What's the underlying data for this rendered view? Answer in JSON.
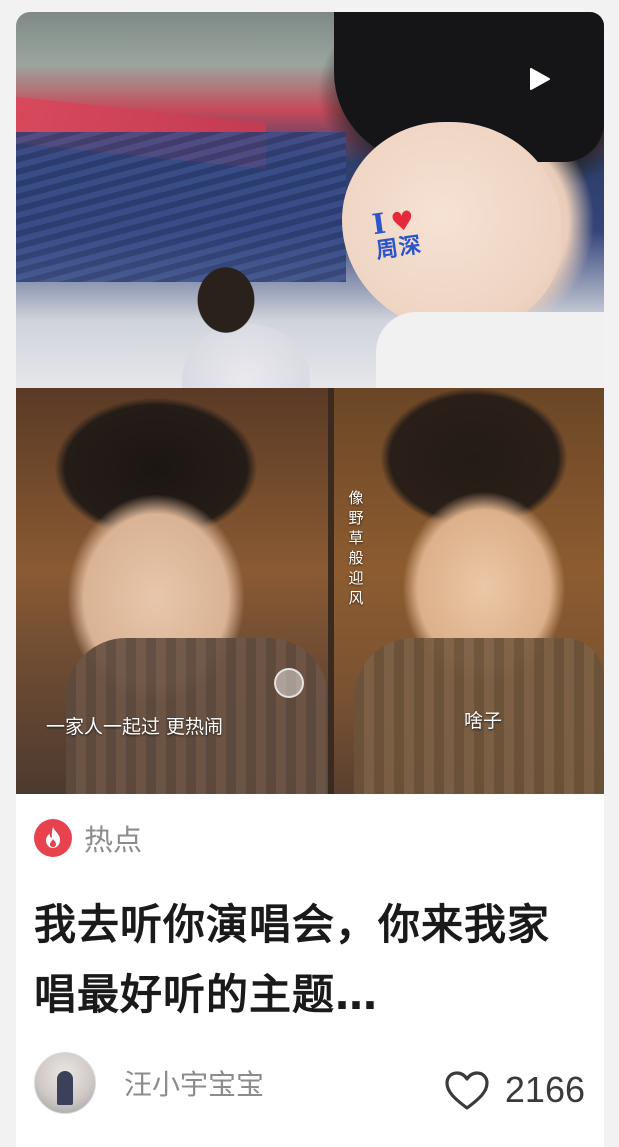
{
  "cover": {
    "sticker_i": "I",
    "sticker_heart": "♥",
    "sticker_text": "周深",
    "caption_left": "一家人一起过 更热闹",
    "caption_right": "啥子",
    "caption_vertical": "像野草般迎风",
    "play_icon": "play-icon"
  },
  "hot": {
    "label": "热点",
    "icon": "fire-icon",
    "color": "#e8424f"
  },
  "title": "我去听你演唱会，你来我家唱最好听的主题…",
  "author": {
    "name": "汪小宇宝宝"
  },
  "likes": {
    "count": "2166",
    "icon": "heart-outline-icon"
  }
}
